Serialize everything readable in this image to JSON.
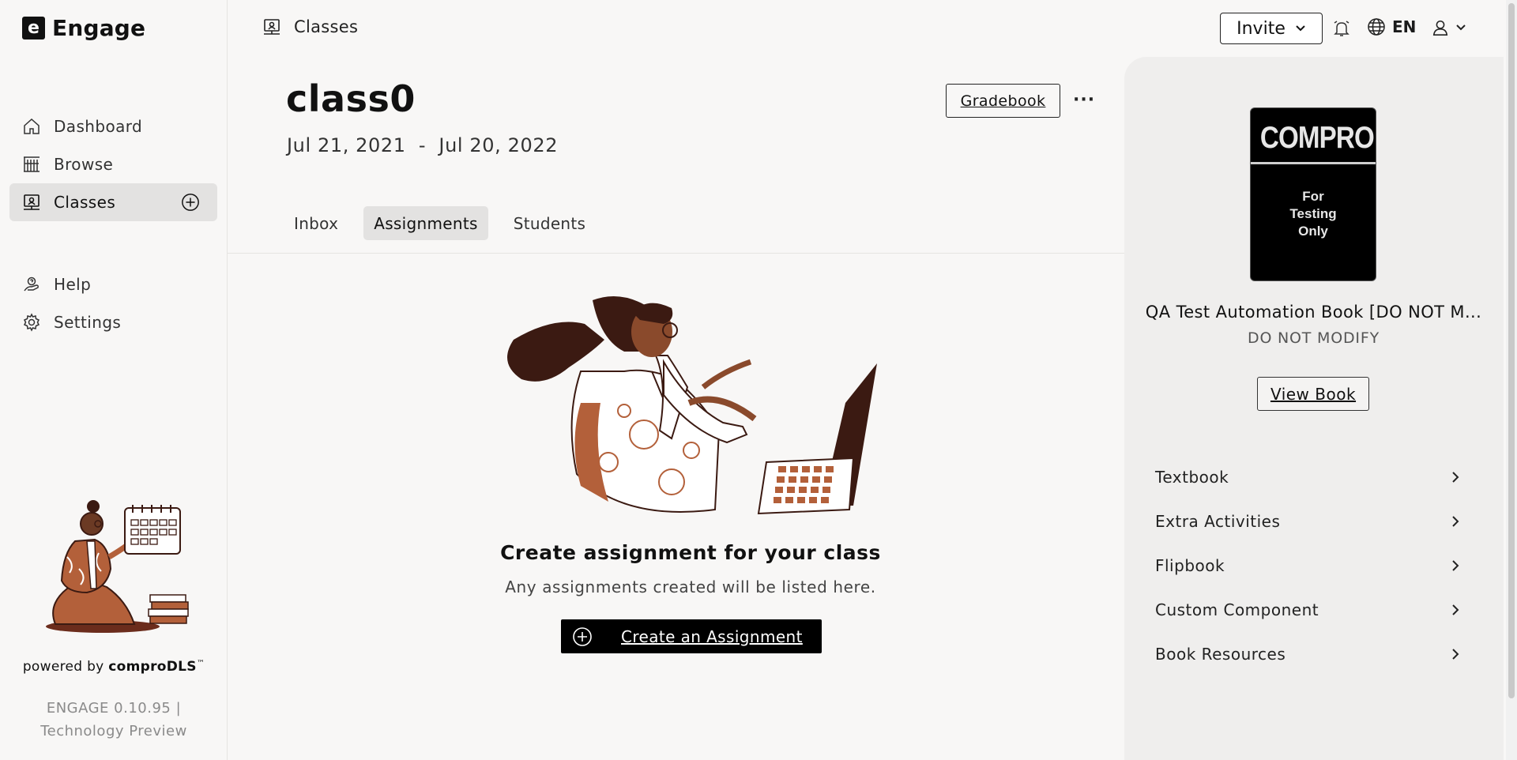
{
  "app": {
    "brand": "Engage",
    "logo_letter": "e"
  },
  "sidebar": {
    "items": [
      {
        "label": "Dashboard",
        "icon": "home-icon"
      },
      {
        "label": "Browse",
        "icon": "library-icon"
      },
      {
        "label": "Classes",
        "icon": "classes-icon",
        "active": true
      }
    ],
    "secondary": [
      {
        "label": "Help",
        "icon": "help-icon"
      },
      {
        "label": "Settings",
        "icon": "gear-icon"
      }
    ],
    "powered_prefix": "powered by ",
    "powered_brand": "comproDLS",
    "powered_tm": "™",
    "version": "ENGAGE 0.10.95 |",
    "version_note": "Technology Preview"
  },
  "header": {
    "breadcrumb": "Classes",
    "invite_label": "Invite",
    "language": "EN"
  },
  "main": {
    "class_name": "class0",
    "date_start": "Jul 21, 2021",
    "date_sep": "-",
    "date_end": "Jul 20, 2022",
    "gradebook_label": "Gradebook",
    "more_label": "···",
    "tabs": [
      {
        "label": "Inbox"
      },
      {
        "label": "Assignments",
        "active": true
      },
      {
        "label": "Students"
      }
    ],
    "empty_title": "Create assignment for your class",
    "empty_subtitle": "Any assignments created will be listed here.",
    "create_label": "Create an Assignment"
  },
  "book": {
    "cover_title": "COMPRO",
    "cover_subtitle": "For\nTesting\nOnly",
    "title": "QA Test Automation Book [DO NOT M...",
    "subtitle": "DO NOT MODIFY",
    "view_label": "View Book",
    "resources": [
      {
        "label": "Textbook"
      },
      {
        "label": "Extra Activities"
      },
      {
        "label": "Flipbook"
      },
      {
        "label": "Custom Component"
      },
      {
        "label": "Book Resources"
      }
    ]
  },
  "colors": {
    "accent": "#000000",
    "illustration_brown": "#b3603a",
    "dark_brown": "#3b1a12",
    "panel": "#efeeed"
  }
}
